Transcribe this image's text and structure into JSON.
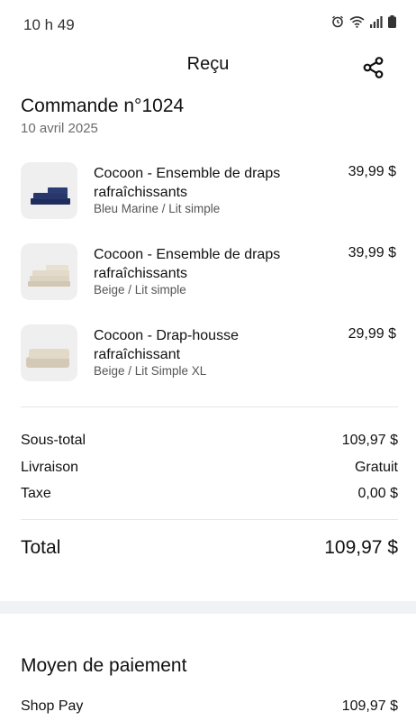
{
  "status": {
    "time": "10 h 49",
    "icons": [
      "alarm-icon",
      "wifi-icon",
      "signal-icon",
      "battery-icon"
    ]
  },
  "header": {
    "title": "Reçu",
    "share_icon": "share-icon"
  },
  "order": {
    "title": "Commande n°1024",
    "date": "10 avril 2025"
  },
  "items": [
    {
      "name": "Cocoon - Ensemble de draps rafraîchissants",
      "variant": "Bleu Marine / Lit simple",
      "price": "39,99 $",
      "thumb_color": "#1f2d5c"
    },
    {
      "name": "Cocoon - Ensemble de draps rafraîchissants",
      "variant": "Beige / Lit simple",
      "price": "39,99 $",
      "thumb_color": "#d9cfbd"
    },
    {
      "name": "Cocoon - Drap-housse rafraîchissant",
      "variant": "Beige / Lit Simple XL",
      "price": "29,99 $",
      "thumb_color": "#dcd2c2"
    }
  ],
  "summary": {
    "subtotal_label": "Sous-total",
    "subtotal_value": "109,97 $",
    "shipping_label": "Livraison",
    "shipping_value": "Gratuit",
    "tax_label": "Taxe",
    "tax_value": "0,00 $",
    "total_label": "Total",
    "total_value": "109,97 $"
  },
  "payment": {
    "title": "Moyen de paiement",
    "method": "Shop Pay",
    "amount": "109,97 $"
  }
}
